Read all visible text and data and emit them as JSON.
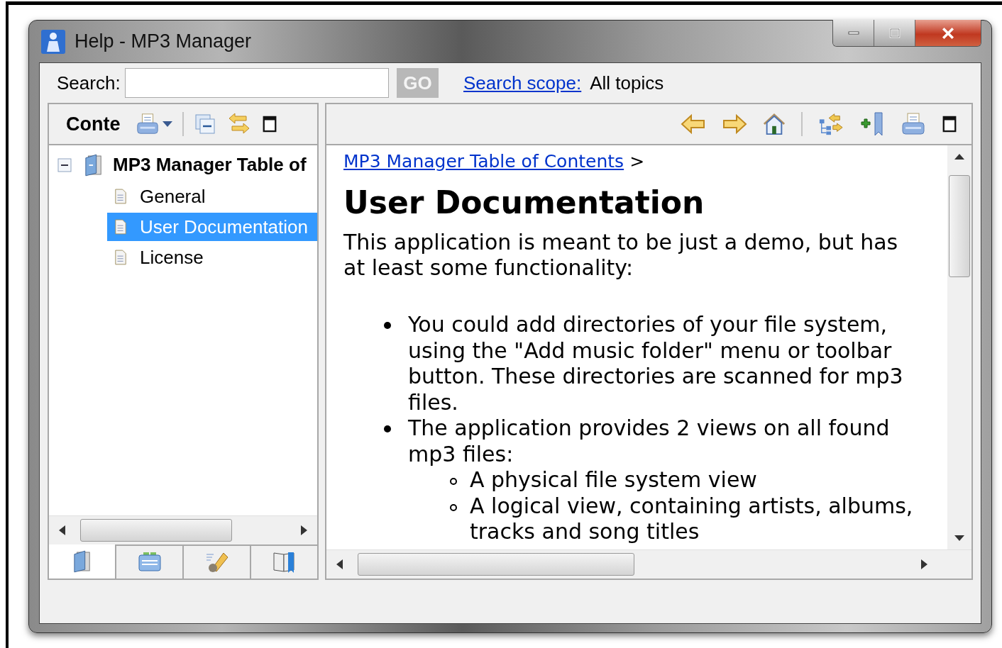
{
  "window": {
    "title": "Help - MP3 Manager"
  },
  "search": {
    "label": "Search:",
    "go_button": "GO",
    "go_disabled": true,
    "scope_link": "Search scope:",
    "scope_value": "All topics"
  },
  "left_pane": {
    "title": "Conte"
  },
  "tree": [
    {
      "label": "MP3 Manager Table of",
      "expanded": true,
      "selected": false,
      "children": [
        {
          "label": "General",
          "selected": false
        },
        {
          "label": "User Documentation",
          "selected": true
        },
        {
          "label": "License",
          "selected": false
        }
      ]
    }
  ],
  "bottom_tabs": [
    {
      "kind": "contents",
      "selected": true
    },
    {
      "kind": "index",
      "selected": false
    },
    {
      "kind": "search",
      "selected": false
    },
    {
      "kind": "bookmarks",
      "selected": false
    }
  ],
  "breadcrumb": {
    "link": "MP3 Manager Table of Contents",
    "separator": ">"
  },
  "heading": "User Documentation",
  "intro": "This application is meant to be just a demo, but has at least some functionality:",
  "bullets": [
    {
      "text": "You could add directories of your file system, using the \"Add music folder\" menu or toolbar button. These directories are scanned for mp3 files."
    },
    {
      "text": "The application provides 2 views on all found mp3 files:",
      "children": [
        {
          "text": "A physical file system view"
        },
        {
          "text": "A logical view, containing artists, albums, tracks and song titles"
        }
      ]
    }
  ]
}
